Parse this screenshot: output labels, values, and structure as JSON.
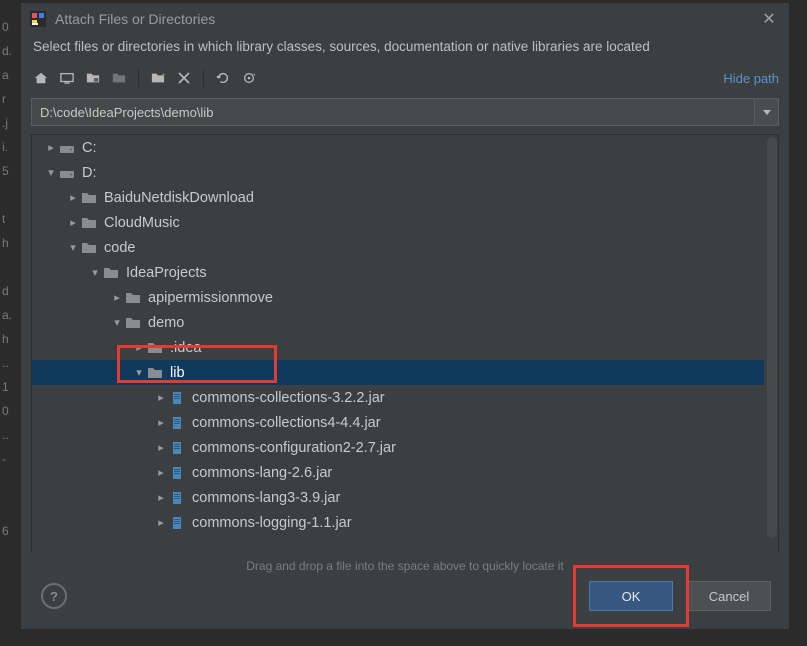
{
  "window": {
    "title": "Attach Files or Directories",
    "subtitle": "Select files or directories in which library classes, sources, documentation or native libraries are located"
  },
  "toolbar": {
    "hide_path": "Hide path"
  },
  "path": {
    "value": "D:\\code\\IdeaProjects\\demo\\lib"
  },
  "tree": {
    "rows": [
      {
        "indent": 0,
        "chev": "collapsed",
        "icon": "drive",
        "label": "C:"
      },
      {
        "indent": 0,
        "chev": "expanded",
        "icon": "drive",
        "label": "D:"
      },
      {
        "indent": 1,
        "chev": "collapsed",
        "icon": "folder",
        "label": "BaiduNetdiskDownload"
      },
      {
        "indent": 1,
        "chev": "collapsed",
        "icon": "folder",
        "label": "CloudMusic"
      },
      {
        "indent": 1,
        "chev": "expanded",
        "icon": "folder",
        "label": "code"
      },
      {
        "indent": 2,
        "chev": "expanded",
        "icon": "folder",
        "label": "IdeaProjects"
      },
      {
        "indent": 3,
        "chev": "collapsed",
        "icon": "folder",
        "label": "apipermissionmove"
      },
      {
        "indent": 3,
        "chev": "expanded",
        "icon": "folder",
        "label": "demo"
      },
      {
        "indent": 4,
        "chev": "collapsed",
        "icon": "folder",
        "label": ".idea"
      },
      {
        "indent": 4,
        "chev": "expanded",
        "icon": "folder",
        "label": "lib",
        "selected": true
      },
      {
        "indent": 5,
        "chev": "collapsed",
        "icon": "jar",
        "label": "commons-collections-3.2.2.jar"
      },
      {
        "indent": 5,
        "chev": "collapsed",
        "icon": "jar",
        "label": "commons-collections4-4.4.jar"
      },
      {
        "indent": 5,
        "chev": "collapsed",
        "icon": "jar",
        "label": "commons-configuration2-2.7.jar"
      },
      {
        "indent": 5,
        "chev": "collapsed",
        "icon": "jar",
        "label": "commons-lang-2.6.jar"
      },
      {
        "indent": 5,
        "chev": "collapsed",
        "icon": "jar",
        "label": "commons-lang3-3.9.jar"
      },
      {
        "indent": 5,
        "chev": "collapsed",
        "icon": "jar",
        "label": "commons-logging-1.1.jar"
      }
    ],
    "hint": "Drag and drop a file into the space above to quickly locate it"
  },
  "buttons": {
    "help": "?",
    "ok": "OK",
    "cancel": "Cancel"
  },
  "backdrop_lines": [
    "0",
    "d.",
    "a",
    "r",
    ".j",
    "i.",
    "5",
    "",
    "t",
    "h",
    "",
    "d",
    "a.",
    "h",
    "..",
    "1",
    "0",
    "..",
    "-",
    "",
    "",
    "6"
  ]
}
